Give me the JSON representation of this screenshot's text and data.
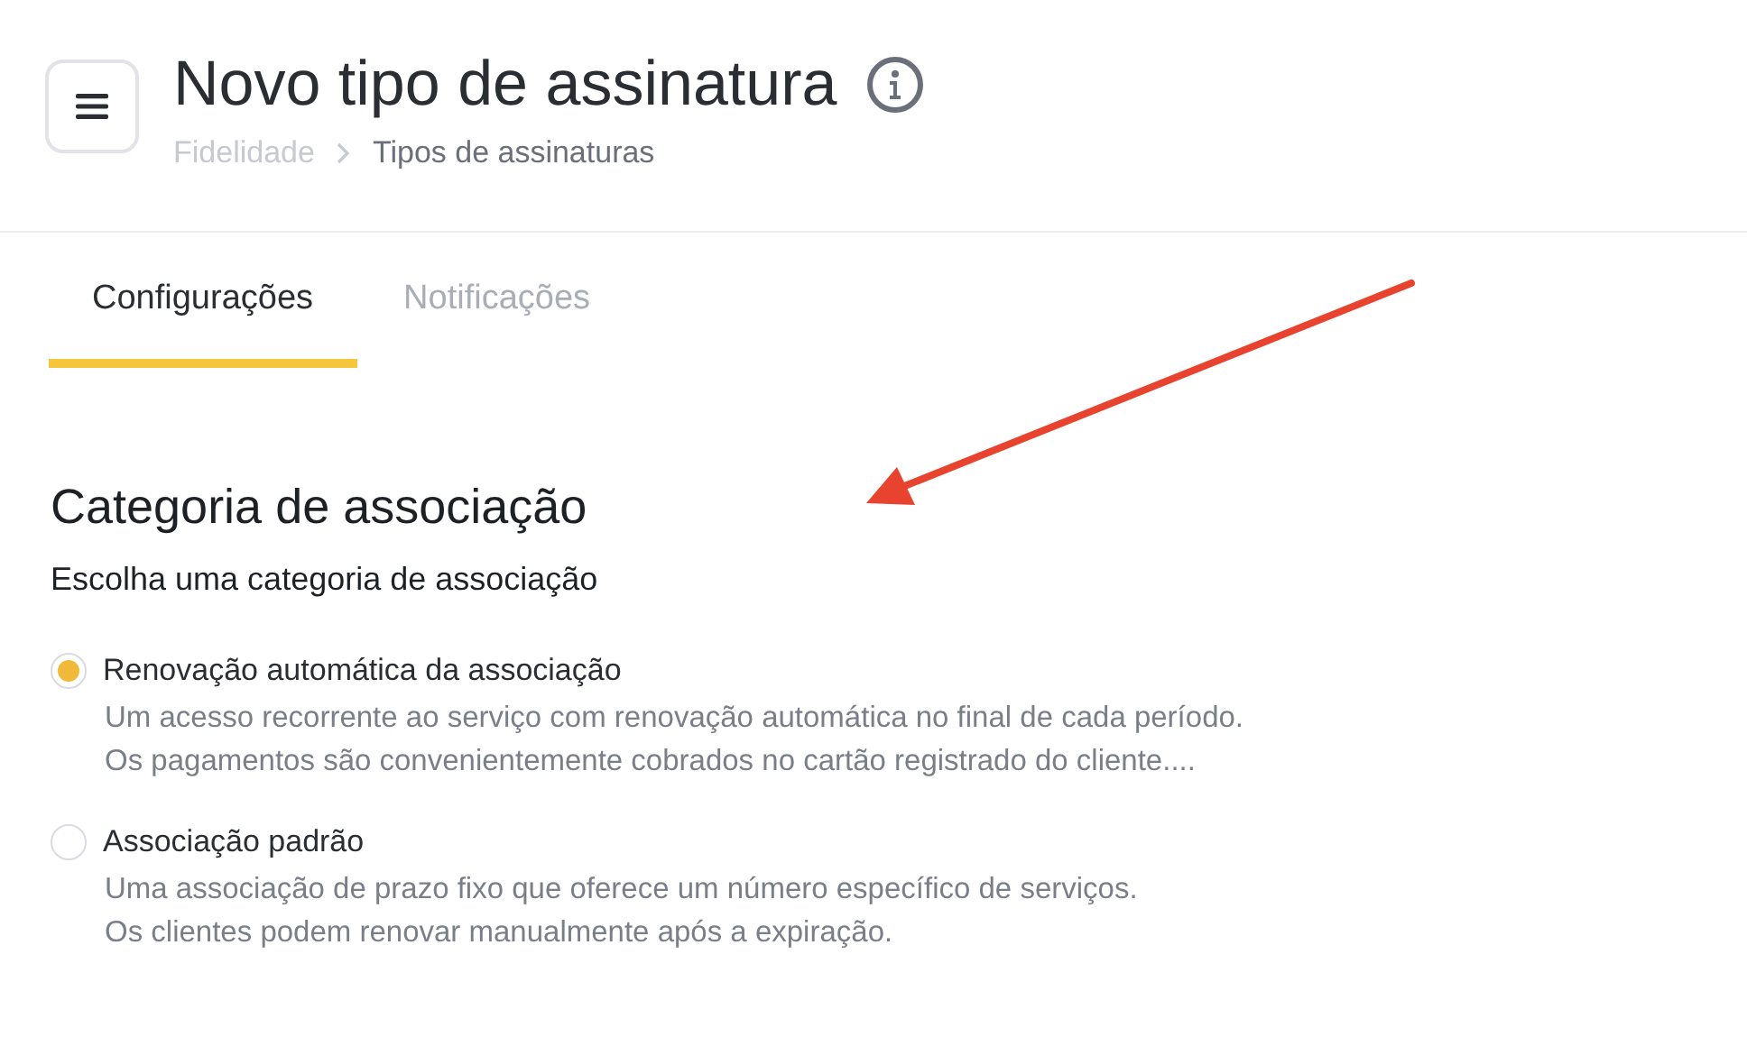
{
  "header": {
    "title": "Novo tipo de assinatura",
    "breadcrumbs": [
      {
        "label": "Fidelidade",
        "current": false
      },
      {
        "label": "Tipos de assinaturas",
        "current": true
      }
    ]
  },
  "tabs": [
    {
      "label": "Configurações",
      "selected": true
    },
    {
      "label": "Notificações",
      "selected": false
    }
  ],
  "section": {
    "title": "Categoria de associação",
    "subtitle": "Escolha uma categoria de associação"
  },
  "options": [
    {
      "label": "Renovação automática da associação",
      "selected": true,
      "description": [
        "Um acesso recorrente ao serviço com renovação automática no final de cada período.",
        "Os pagamentos são convenientemente cobrados no cartão registrado do cliente...."
      ]
    },
    {
      "label": "Associação padrão",
      "selected": false,
      "description": [
        "Uma associação de prazo fixo que oferece um número específico de serviços.",
        "Os clientes podem renovar manualmente após a expiração."
      ]
    }
  ]
}
